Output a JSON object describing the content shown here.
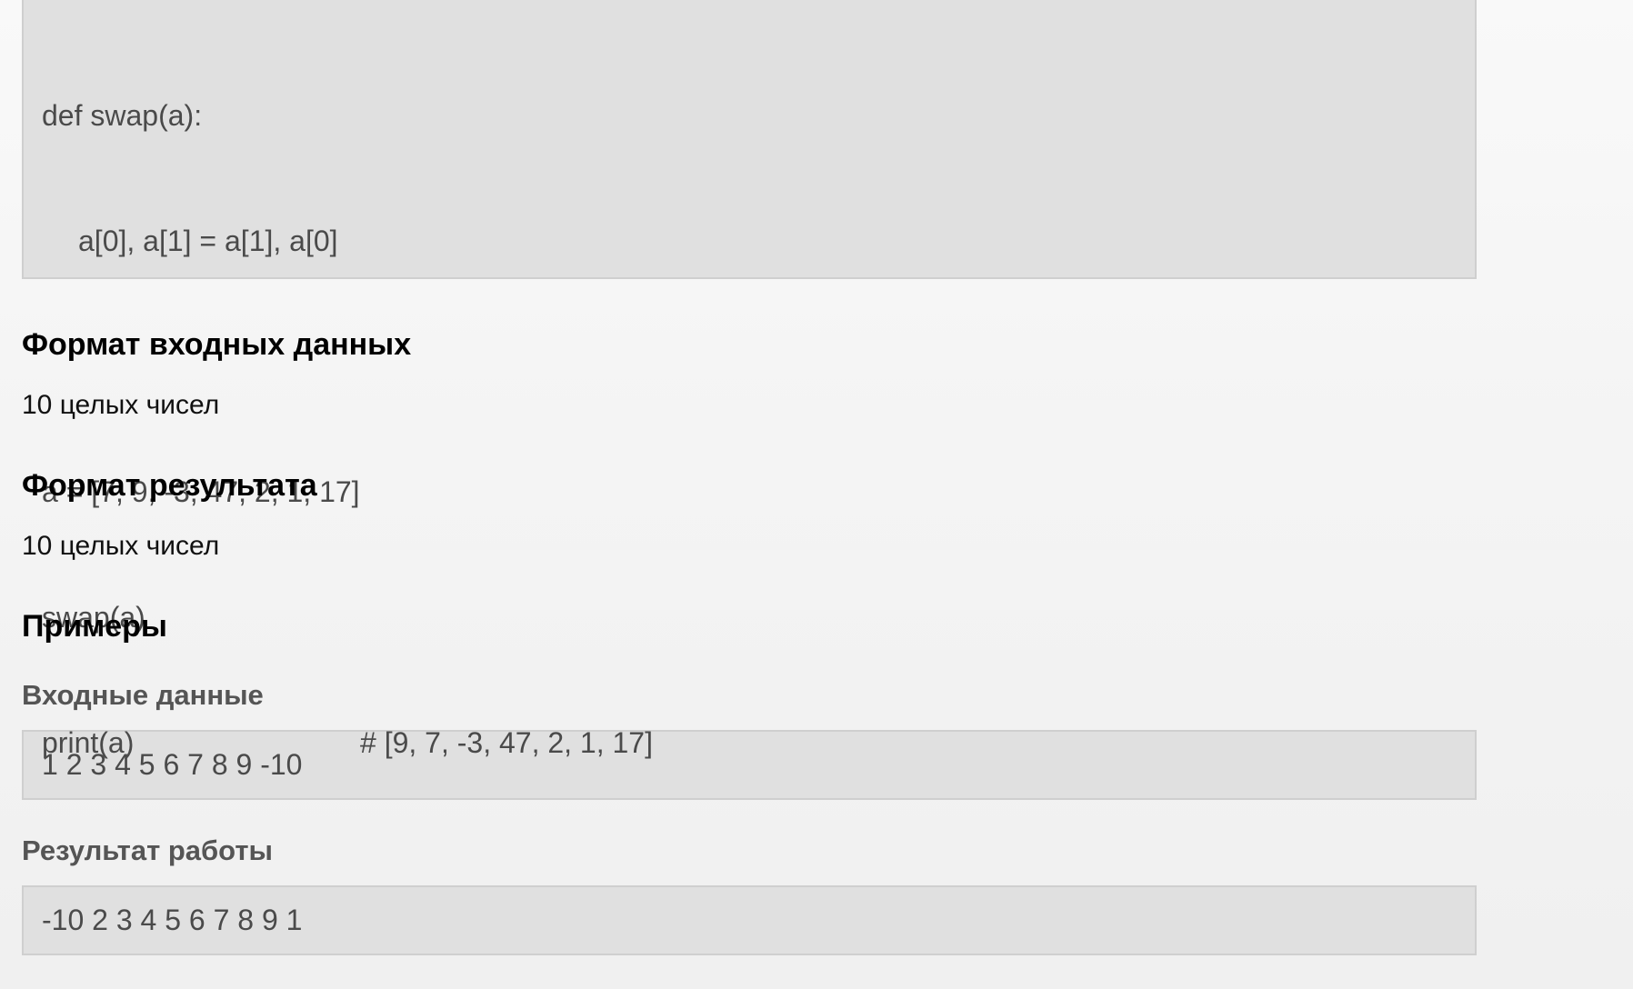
{
  "code_example": {
    "lines": [
      "def swap(a):",
      "a[0], a[1] = a[1], a[0]",
      "",
      "a = [7, 9, -3, 47, 2, 1, 17]",
      "swap(a)",
      "print(a)"
    ],
    "comment": "# [9, 7, -3, 47, 2, 1, 17]"
  },
  "input_format": {
    "title": "Формат входных данных",
    "text": "10 целых чисел"
  },
  "output_format": {
    "title": "Формат результата",
    "text": "10 целых чисел"
  },
  "examples": {
    "title": "Примеры",
    "input_label": "Входные данные",
    "input_value": "1 2 3 4 5 6 7 8 9 -10",
    "output_label": "Результат работы",
    "output_value": "-10 2 3 4 5 6 7 8 9 1"
  }
}
